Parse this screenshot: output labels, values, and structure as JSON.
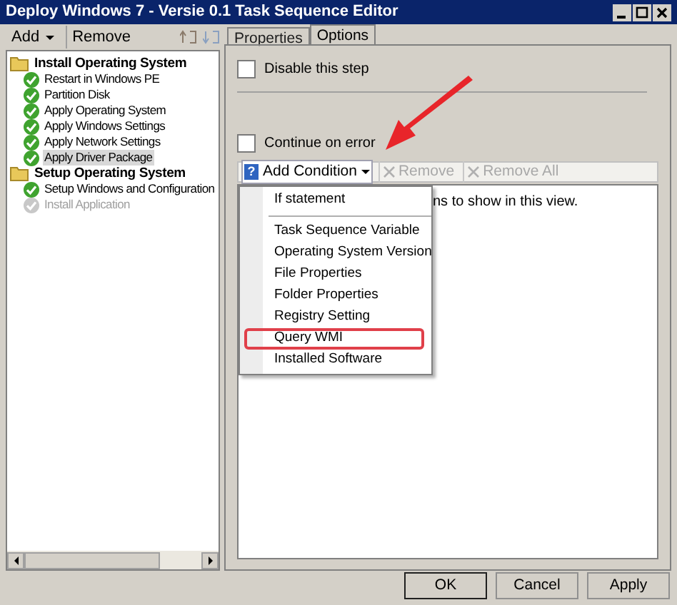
{
  "window": {
    "title": "Deploy Windows 7 - Versie 0.1 Task Sequence Editor"
  },
  "left_toolbar": {
    "add": "Add",
    "remove": "Remove"
  },
  "tree": [
    {
      "label": "Install Operating System",
      "children": [
        {
          "label": "Restart in Windows PE",
          "selected": false,
          "disabled": false
        },
        {
          "label": "Partition Disk",
          "selected": false,
          "disabled": false
        },
        {
          "label": "Apply Operating System",
          "selected": false,
          "disabled": false
        },
        {
          "label": "Apply Windows Settings",
          "selected": false,
          "disabled": false
        },
        {
          "label": "Apply Network Settings",
          "selected": false,
          "disabled": false
        },
        {
          "label": "Apply Driver Package",
          "selected": true,
          "disabled": false
        }
      ]
    },
    {
      "label": "Setup Operating System",
      "children": [
        {
          "label": "Setup Windows and Configuration",
          "selected": false,
          "disabled": false
        },
        {
          "label": "Install Application",
          "selected": false,
          "disabled": true
        }
      ]
    }
  ],
  "tabs": [
    {
      "label": "Properties",
      "selected": false
    },
    {
      "label": "Options",
      "selected": true
    }
  ],
  "options": [
    {
      "label": "Disable this step",
      "checked": false
    },
    {
      "label": "Continue on error",
      "checked": false
    }
  ],
  "condition_toolbar": [
    {
      "kind": "dropdown",
      "icon": "?",
      "label": "Add Condition",
      "disabled": false
    },
    {
      "kind": "remove",
      "label": "Remove",
      "disabled": true
    },
    {
      "kind": "remove_all",
      "label": "Remove All",
      "disabled": true
    }
  ],
  "conditions_list": {
    "empty_text": "ns to show in this view."
  },
  "menu": {
    "groups": [
      [
        {
          "label": "If statement",
          "highlighted": false
        }
      ],
      [
        {
          "label": "Task Sequence Variable",
          "highlighted": false
        },
        {
          "label": "Operating System Version",
          "highlighted": false
        },
        {
          "label": "File Properties",
          "highlighted": false
        },
        {
          "label": "Folder Properties",
          "highlighted": false
        },
        {
          "label": "Registry Setting",
          "highlighted": false
        },
        {
          "label": "Query WMI",
          "highlighted": true
        },
        {
          "label": "Installed Software",
          "highlighted": false
        }
      ]
    ]
  },
  "buttons": [
    "OK",
    "Cancel",
    "Apply"
  ]
}
